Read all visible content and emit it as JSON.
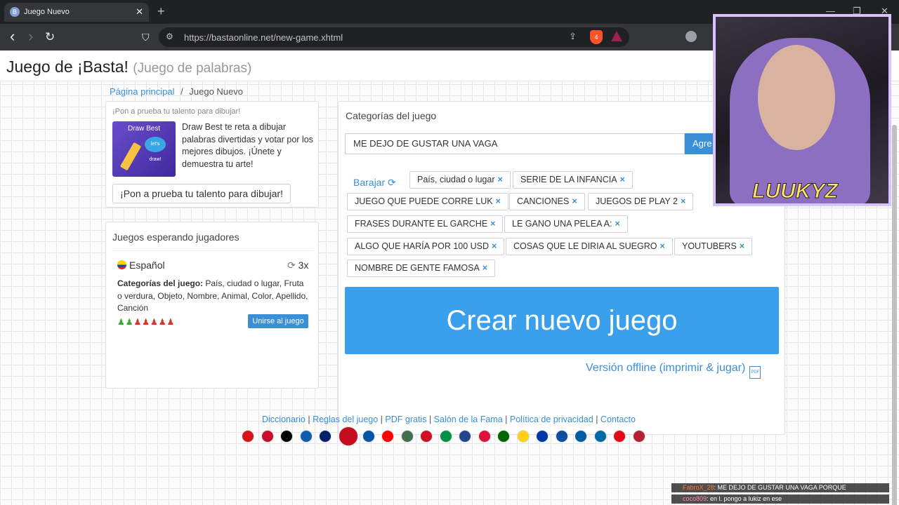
{
  "browser": {
    "tab_title": "Juego Nuevo",
    "tab_close": "✕",
    "new_tab": "+",
    "url": "https://bastaonline.net/new-game.xhtml",
    "win_min": "—",
    "win_max": "❐",
    "win_close": "✕",
    "back": "‹",
    "forward": "›",
    "reload": "↻",
    "bookmark": "⛉",
    "brave_badge": "4"
  },
  "header": {
    "title": "Juego de ¡Basta!",
    "subtitle": "(Juego de palabras)"
  },
  "breadcrumb": {
    "home": "Página principal",
    "sep": "/",
    "current": "Juego Nuevo"
  },
  "promo": {
    "heading": "¡Pon a prueba tu talento para dibujar!",
    "image_title": "Draw Best",
    "image_bubble": "let's draw!",
    "text": "Draw Best te reta a dibujar palabras divertidas y votar por los mejores dibujos. ¡Únete y demuestra tu arte!",
    "button": "¡Pon a prueba tu talento para dibujar!"
  },
  "waiting": {
    "heading": "Juegos esperando jugadores",
    "language": "Español",
    "rounds": "3x",
    "categories_label": "Categorías del juego:",
    "categories_value": " País, ciudad o lugar, Fruta o verdura, Objeto, Nombre, Animal, Color, Apellido, Canción",
    "players_online": "♟♟",
    "players_open": "♟♟♟♟♟",
    "join": "Unirse al juego"
  },
  "categories": {
    "heading": "Categorías del juego",
    "input_value": "ME DEJO DE GUSTAR UNA VAGA",
    "add": "Agre",
    "shuffle": "Barajar ⟳",
    "tags": [
      "País, ciudad o lugar",
      "SERIE DE LA INFANCIA",
      "JUEGO QUE PUEDE CORRE LUK",
      "CANCIONES",
      "JUEGOS DE PLAY 2",
      "FRASES DURANTE EL GARCHE",
      "LE GANO UNA PELEA A:",
      "ALGO QUE HARÍA POR 100 USD",
      "COSAS QUE LE DIRIA AL SUEGRO",
      "YOUTUBERS",
      "NOMBRE DE GENTE FAMOSA"
    ],
    "remove": "×"
  },
  "create_button": "Crear nuevo juego",
  "offline": "Versión offline (imprimir & jugar)",
  "pdf_icon": "PDF",
  "footer": {
    "links": [
      "Diccionario",
      "Reglas del juego",
      "PDF gratis",
      "Salón de la Fama",
      "Política de privacidad",
      "Contacto"
    ],
    "sep": "|"
  },
  "flag_colors": {
    "cz": "#d7141a",
    "dk": "#c8102e",
    "de": "#000000",
    "gr": "#0d5eaf",
    "gb": "#012169",
    "es": "#c60b1e",
    "fr": "#0055a4",
    "hr": "#ff0000",
    "hu": "#436f4d",
    "id": "#ce1126",
    "it": "#009246",
    "nl": "#21468b",
    "pl": "#dc143c",
    "pt": "#006600",
    "ro": "#fcd116",
    "ru": "#0039a6",
    "sk": "#0b4ea2",
    "si": "#005da4",
    "se": "#006aa7",
    "tr": "#e30a17",
    "us": "#b22234"
  },
  "stream": {
    "name": "LUUKYZ",
    "chat": [
      {
        "user": "FabroX_28",
        "text": ": ME DEJO DE GUSTAR UNA VAGA PORQUE"
      },
      {
        "user": "coco809",
        "text": ": en l. pongo a lukiz en ese"
      }
    ]
  }
}
